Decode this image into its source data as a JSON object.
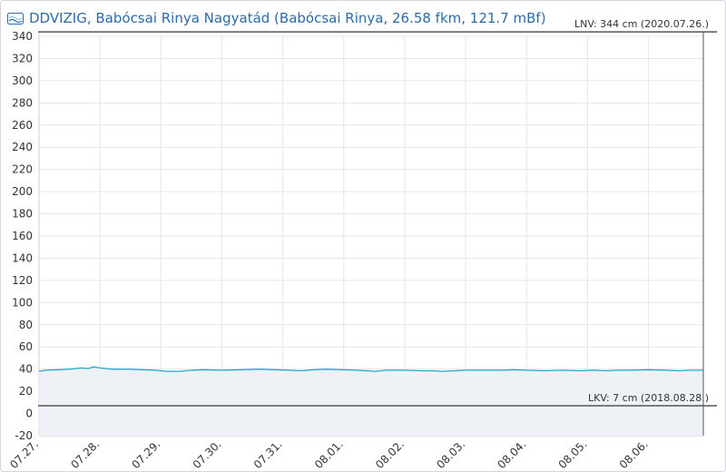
{
  "header": {
    "logo_text": "VIZIG",
    "title": "DDVIZIG, Babócsai Rinya Nagyatád (Babócsai Rinya, 26.58 fkm, 121.7 mBf)"
  },
  "colors": {
    "series": "#25a6c9",
    "area": "#eef2f7",
    "reference": "#555555",
    "grid": "#e6e6e6",
    "title": "#2a6ba8"
  },
  "chart_data": {
    "type": "area",
    "title": "DDVIZIG, Babócsai Rinya Nagyatád (Babócsai Rinya, 26.58 fkm, 121.7 mBf)",
    "xlabel": "",
    "ylabel": "",
    "ylim": [
      -20,
      340
    ],
    "y_ticks": [
      -20,
      0,
      20,
      40,
      60,
      80,
      100,
      120,
      140,
      160,
      180,
      200,
      220,
      240,
      260,
      280,
      300,
      320,
      340
    ],
    "xlim": [
      0,
      10.9
    ],
    "x_tick_positions": [
      0,
      1,
      2,
      3,
      4,
      5,
      6,
      7,
      8,
      9,
      10
    ],
    "x_tick_labels": [
      "07.27.",
      "07.28.",
      "07.29.",
      "07.30.",
      "07.31.",
      "08.01.",
      "08.02.",
      "08.03.",
      "08.04.",
      "08.05.",
      "08.06."
    ],
    "grid": true,
    "reference_lines": [
      {
        "y": 344,
        "label": "LNV: 344 cm (2020.07.26.)",
        "label_position": "top-right"
      },
      {
        "y": 7,
        "label": "LKV: 7 cm (2018.08.28.)",
        "label_position": "top-right"
      }
    ],
    "current_time_line_x": 10.9,
    "series": [
      {
        "x": [
          0,
          0.1,
          0.3,
          0.5,
          0.7,
          0.8,
          0.9,
          1.0,
          1.2,
          1.5,
          1.7,
          1.9,
          2.1,
          2.3,
          2.5,
          2.7,
          3.0,
          3.3,
          3.6,
          3.9,
          4.1,
          4.3,
          4.5,
          4.7,
          5.0,
          5.2,
          5.4,
          5.5,
          5.7,
          6.0,
          6.3,
          6.5,
          6.6,
          6.8,
          7.0,
          7.3,
          7.6,
          7.8,
          8.0,
          8.3,
          8.6,
          8.9,
          9.1,
          9.3,
          9.5,
          9.7,
          10.0,
          10.3,
          10.5,
          10.7,
          10.9
        ],
        "values": [
          38,
          39,
          39.5,
          40,
          41,
          40.5,
          42,
          41,
          40,
          40,
          39.5,
          39,
          38,
          38,
          39,
          39.5,
          39,
          39.5,
          40,
          39.5,
          39,
          38.5,
          39.5,
          40,
          39.5,
          39,
          38.5,
          38,
          39,
          39,
          38.5,
          38.5,
          38,
          38.5,
          39,
          39,
          39,
          39.5,
          39,
          38.5,
          39,
          38.5,
          39,
          38.5,
          39,
          39,
          39.5,
          39,
          38.5,
          39,
          39
        ]
      }
    ]
  }
}
